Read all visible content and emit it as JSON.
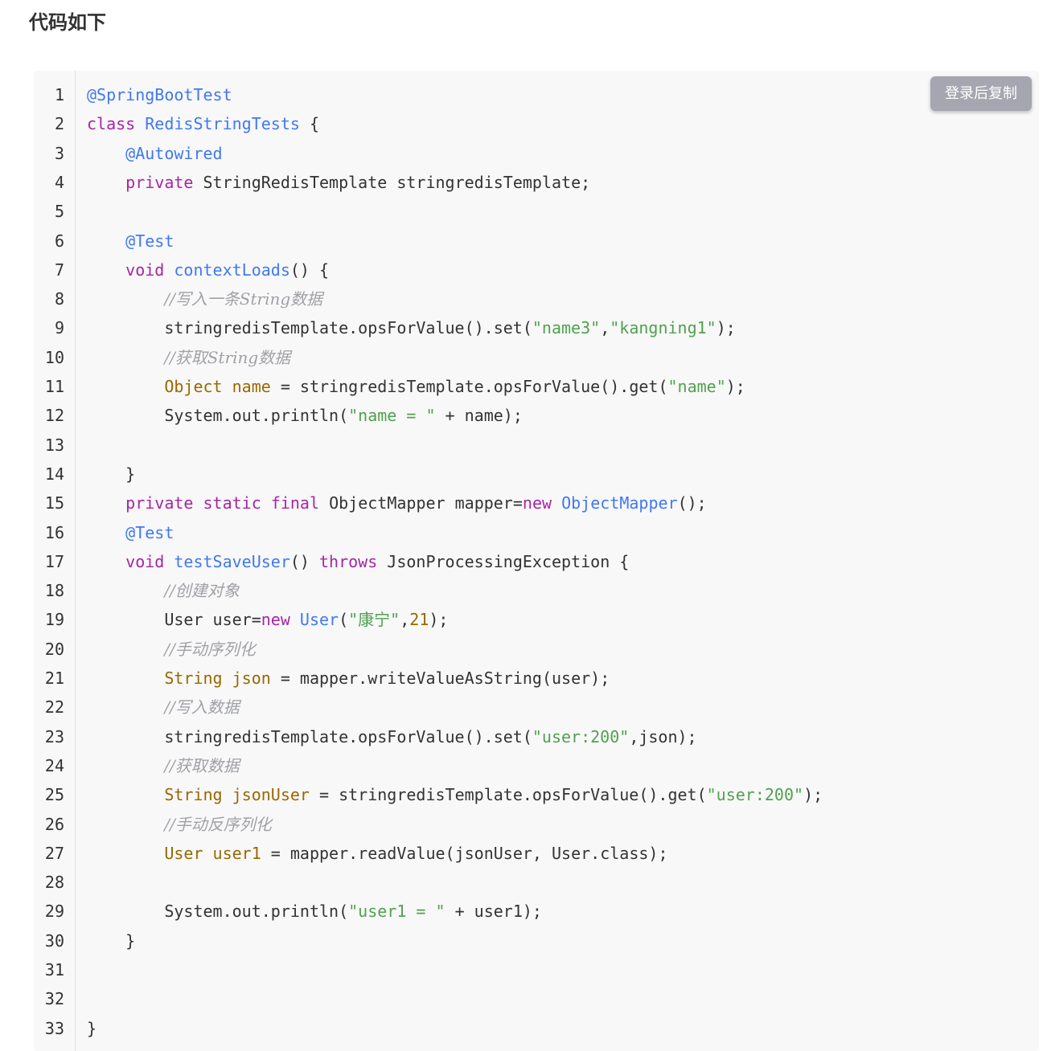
{
  "heading": "代码如下",
  "copy_button_label": "登录后复制",
  "colors": {
    "keyword": "#a626a4",
    "annotation": "#4078f2",
    "function": "#4078f2",
    "string": "#50a14f",
    "number": "#986801",
    "type": "#986801",
    "comment": "#a0a1a7",
    "plain": "#333333",
    "copy_button_bg": "#a6a6b0",
    "code_bg": "#f8f8f8"
  },
  "code": {
    "language": "java",
    "lines": [
      {
        "n": "1",
        "tokens": [
          [
            "anno",
            "@SpringBootTest"
          ]
        ]
      },
      {
        "n": "2",
        "tokens": [
          [
            "kw",
            "class"
          ],
          [
            "plain",
            " "
          ],
          [
            "fn",
            "RedisStringTests"
          ],
          [
            "plain",
            " {"
          ]
        ]
      },
      {
        "n": "3",
        "tokens": [
          [
            "plain",
            "    "
          ],
          [
            "anno",
            "@Autowired"
          ]
        ]
      },
      {
        "n": "4",
        "tokens": [
          [
            "plain",
            "    "
          ],
          [
            "kw",
            "private"
          ],
          [
            "plain",
            " StringRedisTemplate stringredisTemplate;"
          ]
        ]
      },
      {
        "n": "5",
        "tokens": []
      },
      {
        "n": "6",
        "tokens": [
          [
            "plain",
            "    "
          ],
          [
            "anno",
            "@Test"
          ]
        ]
      },
      {
        "n": "7",
        "tokens": [
          [
            "plain",
            "    "
          ],
          [
            "kw",
            "void"
          ],
          [
            "plain",
            " "
          ],
          [
            "fn",
            "contextLoads"
          ],
          [
            "plain",
            "() {"
          ]
        ]
      },
      {
        "n": "8",
        "tokens": [
          [
            "plain",
            "        "
          ],
          [
            "cmt",
            "//写入一条String数据"
          ]
        ]
      },
      {
        "n": "9",
        "tokens": [
          [
            "plain",
            "        stringredisTemplate.opsForValue().set("
          ],
          [
            "str",
            "\"name3\""
          ],
          [
            "plain",
            ","
          ],
          [
            "str",
            "\"kangning1\""
          ],
          [
            "plain",
            ");"
          ]
        ]
      },
      {
        "n": "10",
        "tokens": [
          [
            "plain",
            "        "
          ],
          [
            "cmt",
            "//获取String数据"
          ]
        ]
      },
      {
        "n": "11",
        "tokens": [
          [
            "plain",
            "        "
          ],
          [
            "type",
            "Object"
          ],
          [
            "plain",
            " "
          ],
          [
            "type",
            "name"
          ],
          [
            "plain",
            " = stringredisTemplate.opsForValue().get("
          ],
          [
            "str",
            "\"name\""
          ],
          [
            "plain",
            ");"
          ]
        ]
      },
      {
        "n": "12",
        "tokens": [
          [
            "plain",
            "        System.out.println("
          ],
          [
            "str",
            "\"name = \""
          ],
          [
            "plain",
            " + name);"
          ]
        ]
      },
      {
        "n": "13",
        "tokens": []
      },
      {
        "n": "14",
        "tokens": [
          [
            "plain",
            "    }"
          ]
        ]
      },
      {
        "n": "15",
        "tokens": [
          [
            "plain",
            "    "
          ],
          [
            "kw",
            "private"
          ],
          [
            "plain",
            " "
          ],
          [
            "kw",
            "static"
          ],
          [
            "plain",
            " "
          ],
          [
            "kw",
            "final"
          ],
          [
            "plain",
            " ObjectMapper mapper="
          ],
          [
            "kw",
            "new"
          ],
          [
            "plain",
            " "
          ],
          [
            "fn",
            "ObjectMapper"
          ],
          [
            "plain",
            "();"
          ]
        ]
      },
      {
        "n": "16",
        "tokens": [
          [
            "plain",
            "    "
          ],
          [
            "anno",
            "@Test"
          ]
        ]
      },
      {
        "n": "17",
        "tokens": [
          [
            "plain",
            "    "
          ],
          [
            "kw",
            "void"
          ],
          [
            "plain",
            " "
          ],
          [
            "fn",
            "testSaveUser"
          ],
          [
            "plain",
            "() "
          ],
          [
            "kw",
            "throws"
          ],
          [
            "plain",
            " JsonProcessingException {"
          ]
        ]
      },
      {
        "n": "18",
        "tokens": [
          [
            "plain",
            "        "
          ],
          [
            "cmt",
            "//创建对象"
          ]
        ]
      },
      {
        "n": "19",
        "tokens": [
          [
            "plain",
            "        User user="
          ],
          [
            "kw",
            "new"
          ],
          [
            "plain",
            " "
          ],
          [
            "fn",
            "User"
          ],
          [
            "plain",
            "("
          ],
          [
            "str",
            "\"康宁\""
          ],
          [
            "plain",
            ","
          ],
          [
            "num",
            "21"
          ],
          [
            "plain",
            ");"
          ]
        ]
      },
      {
        "n": "20",
        "tokens": [
          [
            "plain",
            "        "
          ],
          [
            "cmt",
            "//手动序列化"
          ]
        ]
      },
      {
        "n": "21",
        "tokens": [
          [
            "plain",
            "        "
          ],
          [
            "type",
            "String"
          ],
          [
            "plain",
            " "
          ],
          [
            "type",
            "json"
          ],
          [
            "plain",
            " = mapper.writeValueAsString(user);"
          ]
        ]
      },
      {
        "n": "22",
        "tokens": [
          [
            "plain",
            "        "
          ],
          [
            "cmt",
            "//写入数据"
          ]
        ]
      },
      {
        "n": "23",
        "tokens": [
          [
            "plain",
            "        stringredisTemplate.opsForValue().set("
          ],
          [
            "str",
            "\"user:200\""
          ],
          [
            "plain",
            ",json);"
          ]
        ]
      },
      {
        "n": "24",
        "tokens": [
          [
            "plain",
            "        "
          ],
          [
            "cmt",
            "//获取数据"
          ]
        ]
      },
      {
        "n": "25",
        "tokens": [
          [
            "plain",
            "        "
          ],
          [
            "type",
            "String"
          ],
          [
            "plain",
            " "
          ],
          [
            "type",
            "jsonUser"
          ],
          [
            "plain",
            " = stringredisTemplate.opsForValue().get("
          ],
          [
            "str",
            "\"user:200\""
          ],
          [
            "plain",
            ");"
          ]
        ]
      },
      {
        "n": "26",
        "tokens": [
          [
            "plain",
            "        "
          ],
          [
            "cmt",
            "//手动反序列化"
          ]
        ]
      },
      {
        "n": "27",
        "tokens": [
          [
            "plain",
            "        "
          ],
          [
            "type",
            "User"
          ],
          [
            "plain",
            " "
          ],
          [
            "type",
            "user1"
          ],
          [
            "plain",
            " = mapper.readValue(jsonUser, User.class);"
          ]
        ]
      },
      {
        "n": "28",
        "tokens": []
      },
      {
        "n": "29",
        "tokens": [
          [
            "plain",
            "        System.out.println("
          ],
          [
            "str",
            "\"user1 = \""
          ],
          [
            "plain",
            " + user1);"
          ]
        ]
      },
      {
        "n": "30",
        "tokens": [
          [
            "plain",
            "    }"
          ]
        ]
      },
      {
        "n": "31",
        "tokens": []
      },
      {
        "n": "32",
        "tokens": []
      },
      {
        "n": "33",
        "tokens": [
          [
            "plain",
            "}"
          ]
        ]
      }
    ]
  }
}
